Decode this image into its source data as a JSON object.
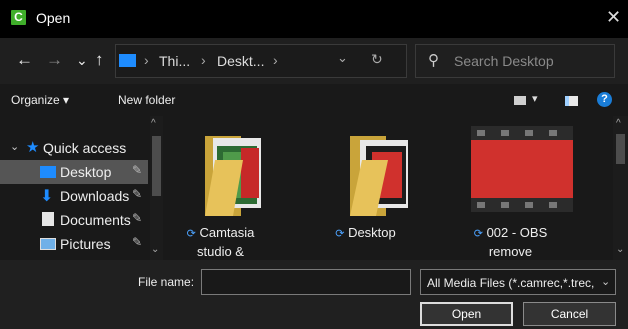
{
  "window": {
    "title": "Open",
    "app_icon": "camtasia-icon",
    "close_glyph": "✕"
  },
  "nav": {
    "back": "←",
    "forward": "→",
    "recent": "⌄",
    "up": "↑",
    "breadcrumbs": [
      "Thi...",
      "Deskt..."
    ],
    "refresh": "↻",
    "search_placeholder": "Search Desktop"
  },
  "toolbar": {
    "organize": "Organize ▾",
    "new_folder": "New folder",
    "help": "?"
  },
  "sidebar": {
    "quick_access": "Quick access",
    "items": [
      {
        "label": "Desktop",
        "icon": "desktop-icon",
        "selected": true
      },
      {
        "label": "Downloads",
        "icon": "download-icon",
        "selected": false
      },
      {
        "label": "Documents",
        "icon": "documents-icon",
        "selected": false
      },
      {
        "label": "Pictures",
        "icon": "pictures-icon",
        "selected": false
      }
    ]
  },
  "files": [
    {
      "name_line1": "Camtasia",
      "name_line2": "studio &",
      "type": "folder-with-thumb"
    },
    {
      "name_line1": "Desktop",
      "name_line2": "",
      "type": "folder-video"
    },
    {
      "name_line1": "002 - OBS",
      "name_line2": "remove",
      "type": "video-thumb"
    }
  ],
  "footer": {
    "file_name_label": "File name:",
    "file_name_value": "",
    "filter": "All Media Files (*.camrec,*.trec,",
    "open_label": "Open",
    "cancel_label": "Cancel"
  },
  "colors": {
    "accent": "#1e8cff",
    "brand": "#3fae2a",
    "selection": "#555555"
  }
}
